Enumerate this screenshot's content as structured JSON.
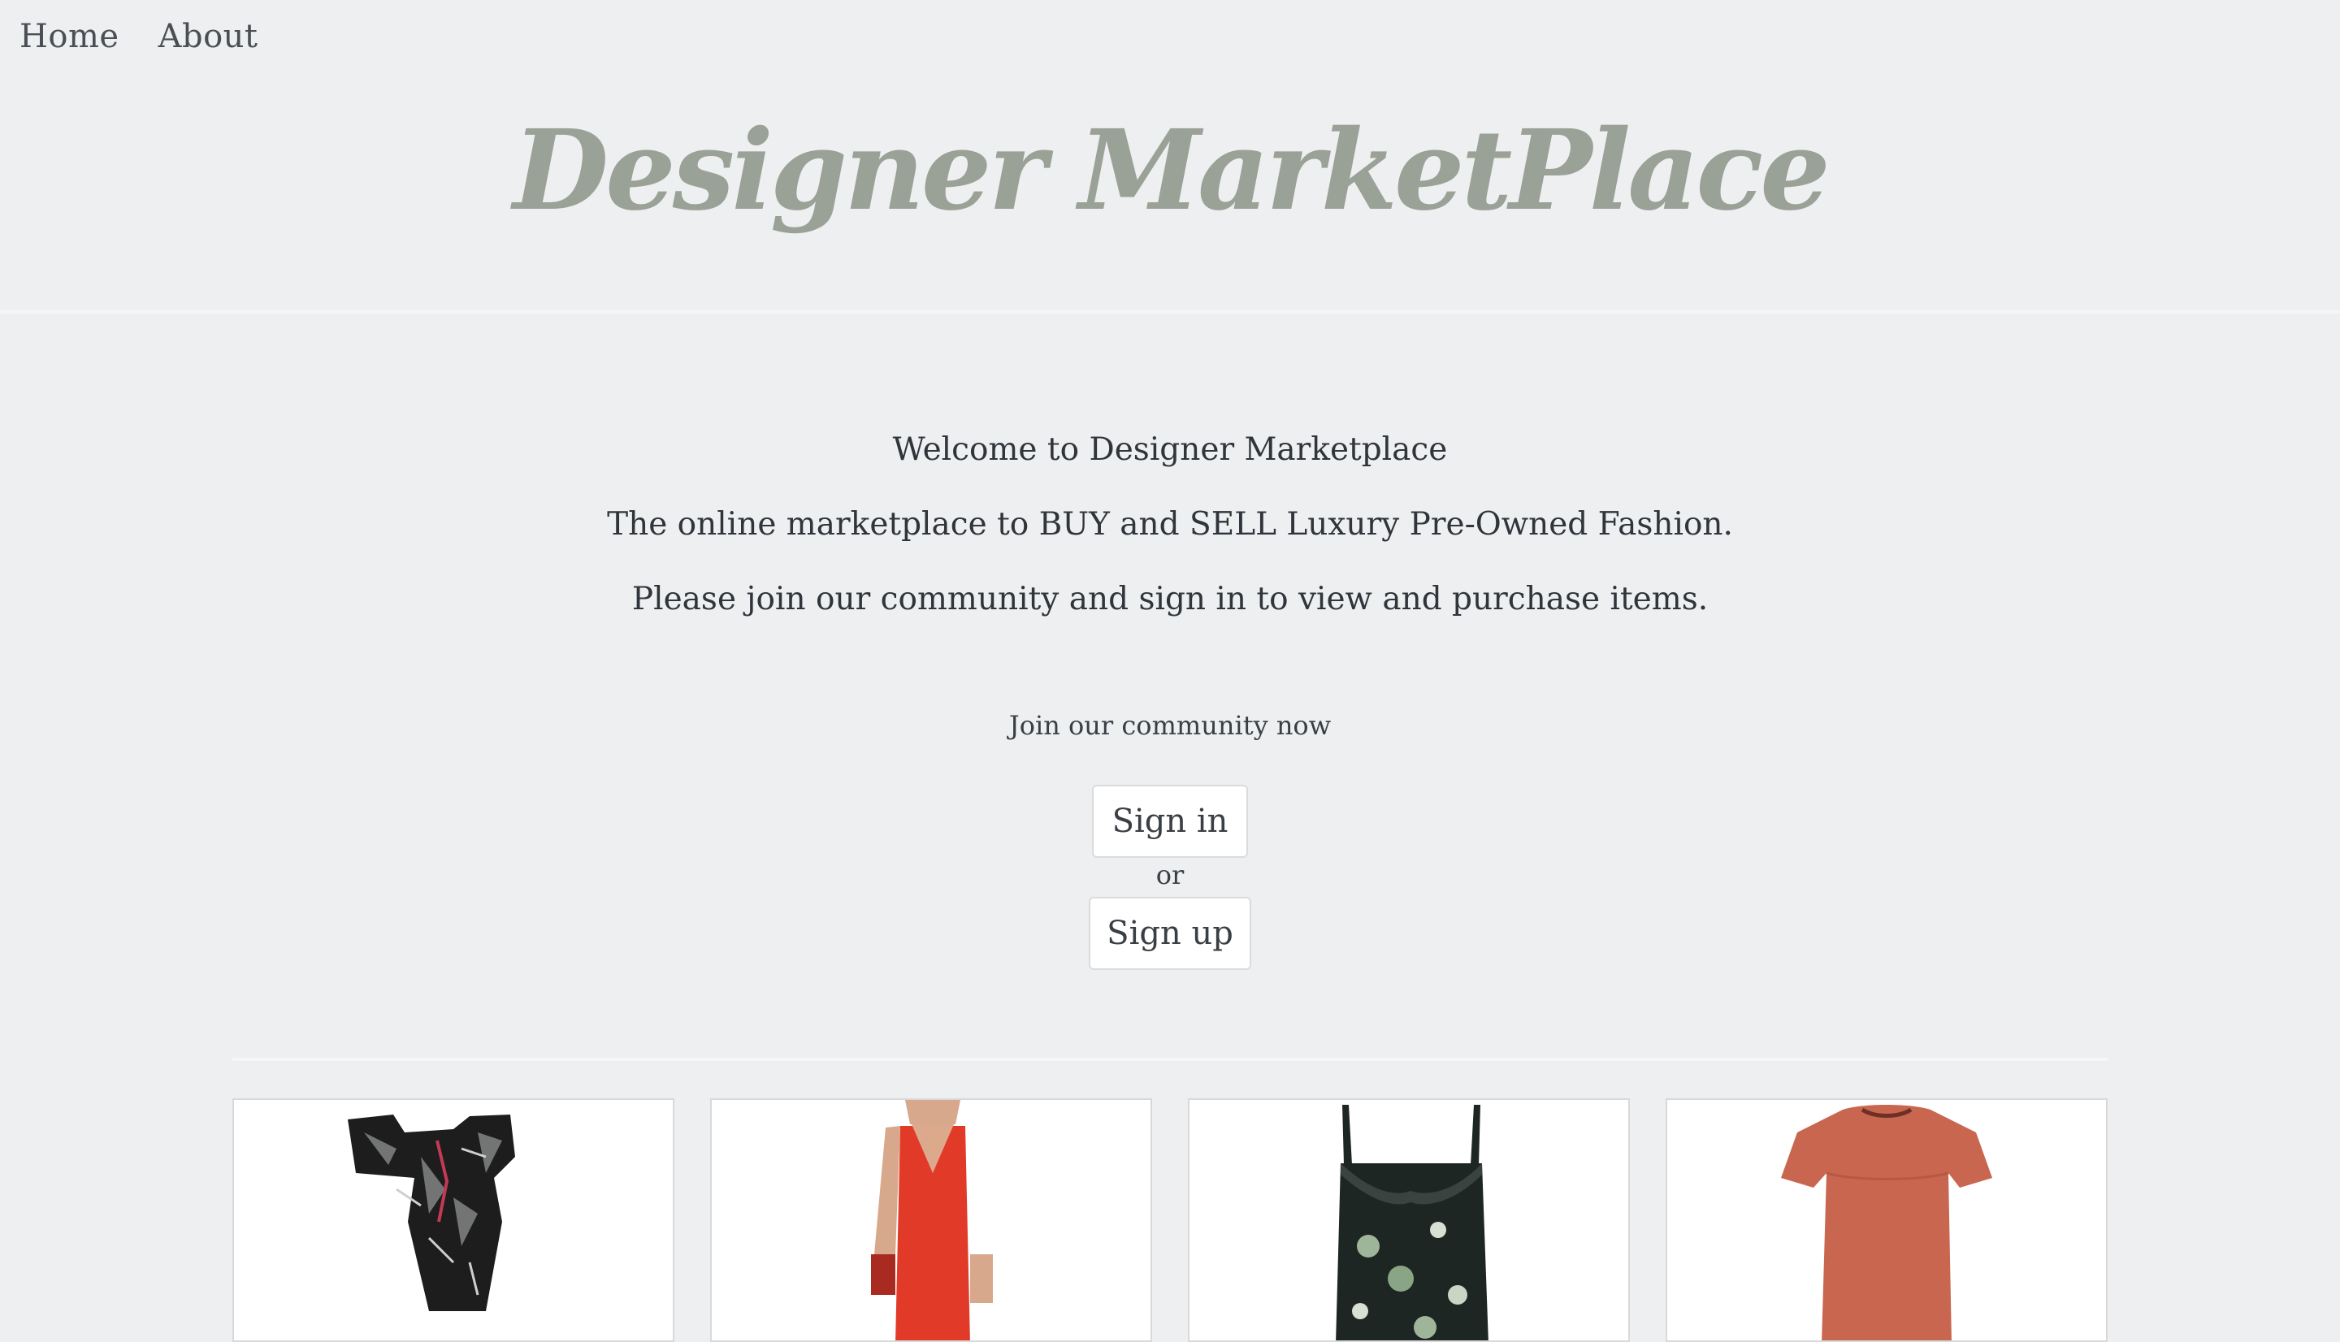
{
  "nav": {
    "home": "Home",
    "about": "About"
  },
  "brand": {
    "title": "Designer MarketPlace",
    "color": "#9aa197"
  },
  "welcome": {
    "line1": "Welcome to Designer Marketplace",
    "line2": "The online marketplace to BUY and SELL Luxury Pre-Owned Fashion.",
    "line3": "Please join our community and sign in to view and purchase items."
  },
  "community": {
    "prompt": "Join our community now",
    "signin_label": "Sign in",
    "or_label": "or",
    "signup_label": "Sign up"
  },
  "products": [
    {
      "name": "black-lace-romper",
      "color": "#1c1d1c"
    },
    {
      "name": "red-slip-dress",
      "color": "#e23a29"
    },
    {
      "name": "dark-floral-slip-dress",
      "color": "#1e2624"
    },
    {
      "name": "orange-short-sleeve-dress",
      "color": "#c96650"
    }
  ]
}
